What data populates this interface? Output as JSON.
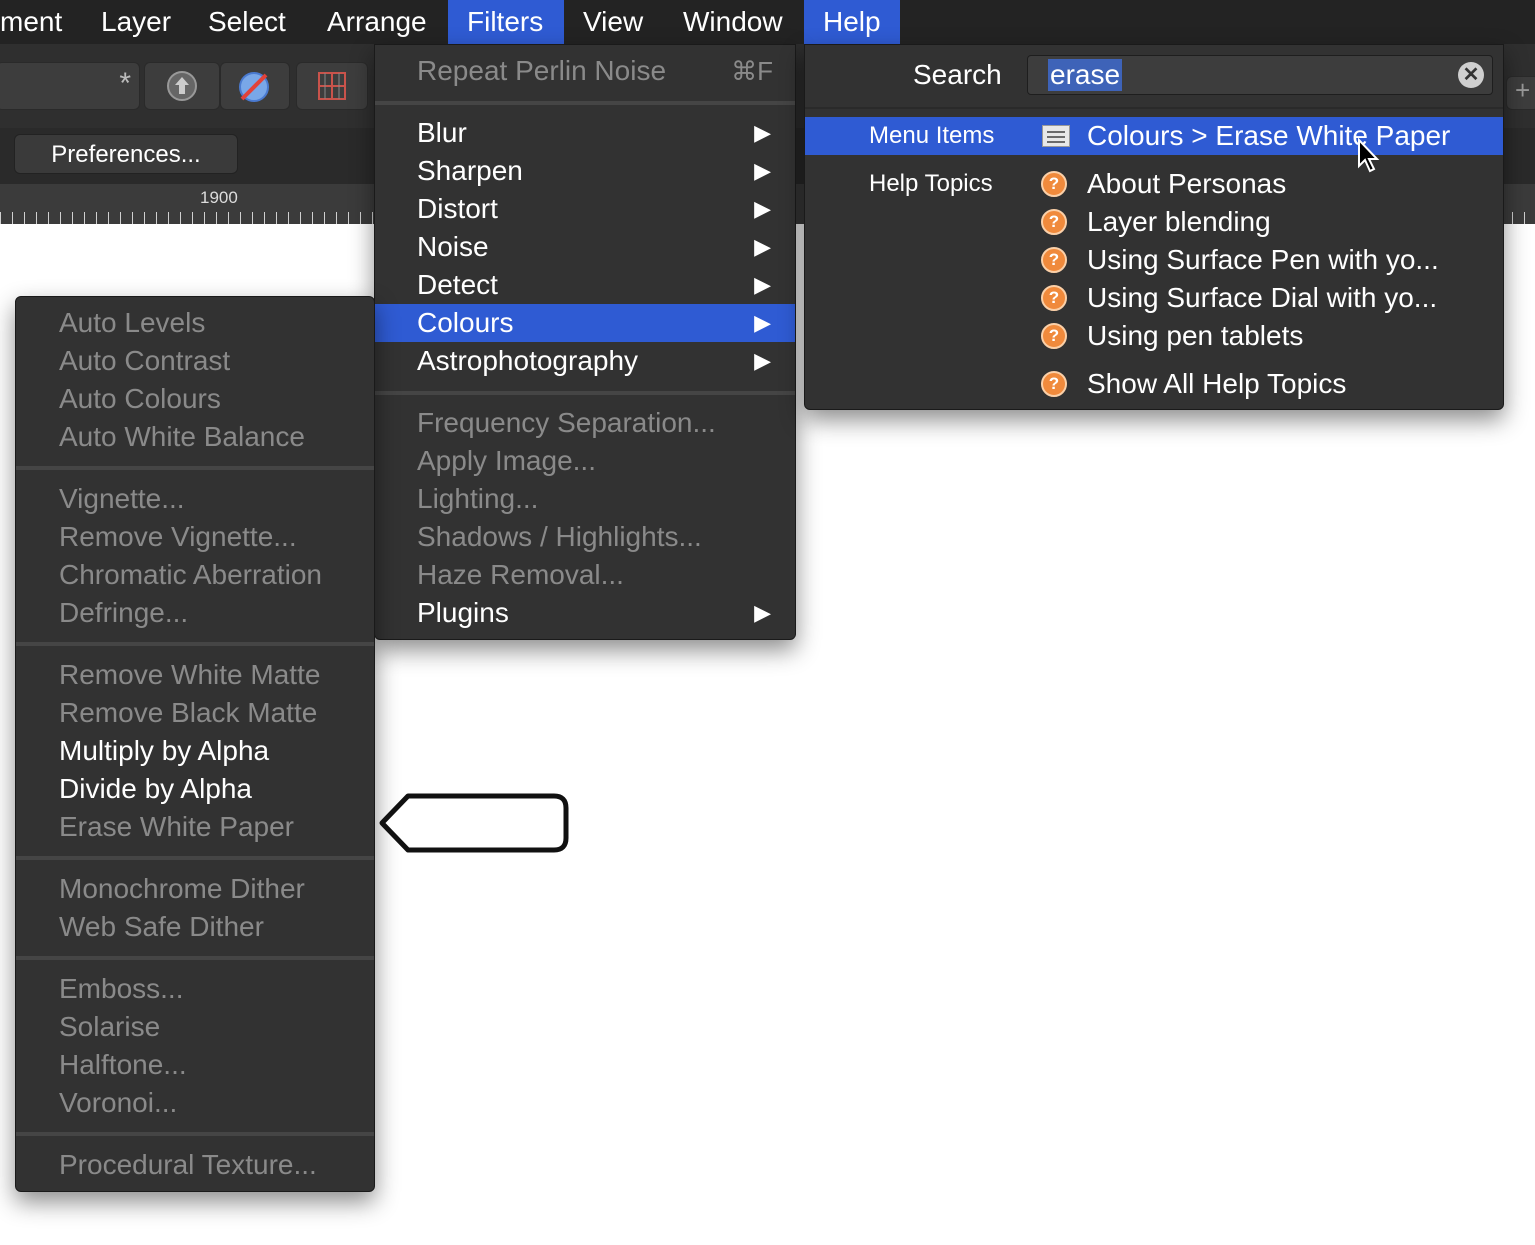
{
  "menubar": {
    "items": [
      "ment",
      "Layer",
      "Select",
      "Arrange",
      "Filters",
      "View",
      "Window",
      "Help"
    ],
    "active": [
      "Filters",
      "Help"
    ]
  },
  "toolbar": {
    "preferences_label": "Preferences...",
    "ruler_label": "1900",
    "icons": [
      "asterisk-icon",
      "upload-icon",
      "no-symbol-icon",
      "grid-icon"
    ]
  },
  "filters_menu": {
    "repeat": {
      "label": "Repeat Perlin Noise",
      "shortcut": "⌘F"
    },
    "submenus": [
      "Blur",
      "Sharpen",
      "Distort",
      "Noise",
      "Detect",
      "Colours",
      "Astrophotography"
    ],
    "highlighted": "Colours",
    "disabled_items": [
      "Frequency Separation...",
      "Apply Image...",
      "Lighting...",
      "Shadows / Highlights...",
      "Haze Removal..."
    ],
    "plugins": "Plugins"
  },
  "colours_menu": {
    "group1": [
      "Auto Levels",
      "Auto Contrast",
      "Auto Colours",
      "Auto White Balance"
    ],
    "group2": [
      "Vignette...",
      "Remove Vignette...",
      "Chromatic Aberration",
      "Defringe..."
    ],
    "group3": [
      "Remove White Matte",
      "Remove Black Matte",
      "Multiply by Alpha",
      "Divide by Alpha",
      "Erase White Paper"
    ],
    "group4": [
      "Monochrome Dither",
      "Web Safe Dither"
    ],
    "group5": [
      "Emboss...",
      "Solarise",
      "Halftone...",
      "Voronoi..."
    ],
    "group6": [
      "Procedural Texture..."
    ],
    "enabled": [
      "Multiply by Alpha",
      "Divide by Alpha"
    ]
  },
  "help_menu": {
    "search_label": "Search",
    "search_value": "erase",
    "menu_items_label": "Menu Items",
    "menu_result": "Colours > Erase White Paper",
    "help_topics_label": "Help Topics",
    "topics": [
      "About Personas",
      "Layer blending",
      "Using Surface Pen with yo...",
      "Using Surface Dial with yo...",
      "Using pen tablets"
    ],
    "show_all": "Show All Help Topics"
  },
  "colors": {
    "highlight": "#2f5bd3",
    "menu_bg": "#323232",
    "help_icon": "#f08a3c"
  }
}
